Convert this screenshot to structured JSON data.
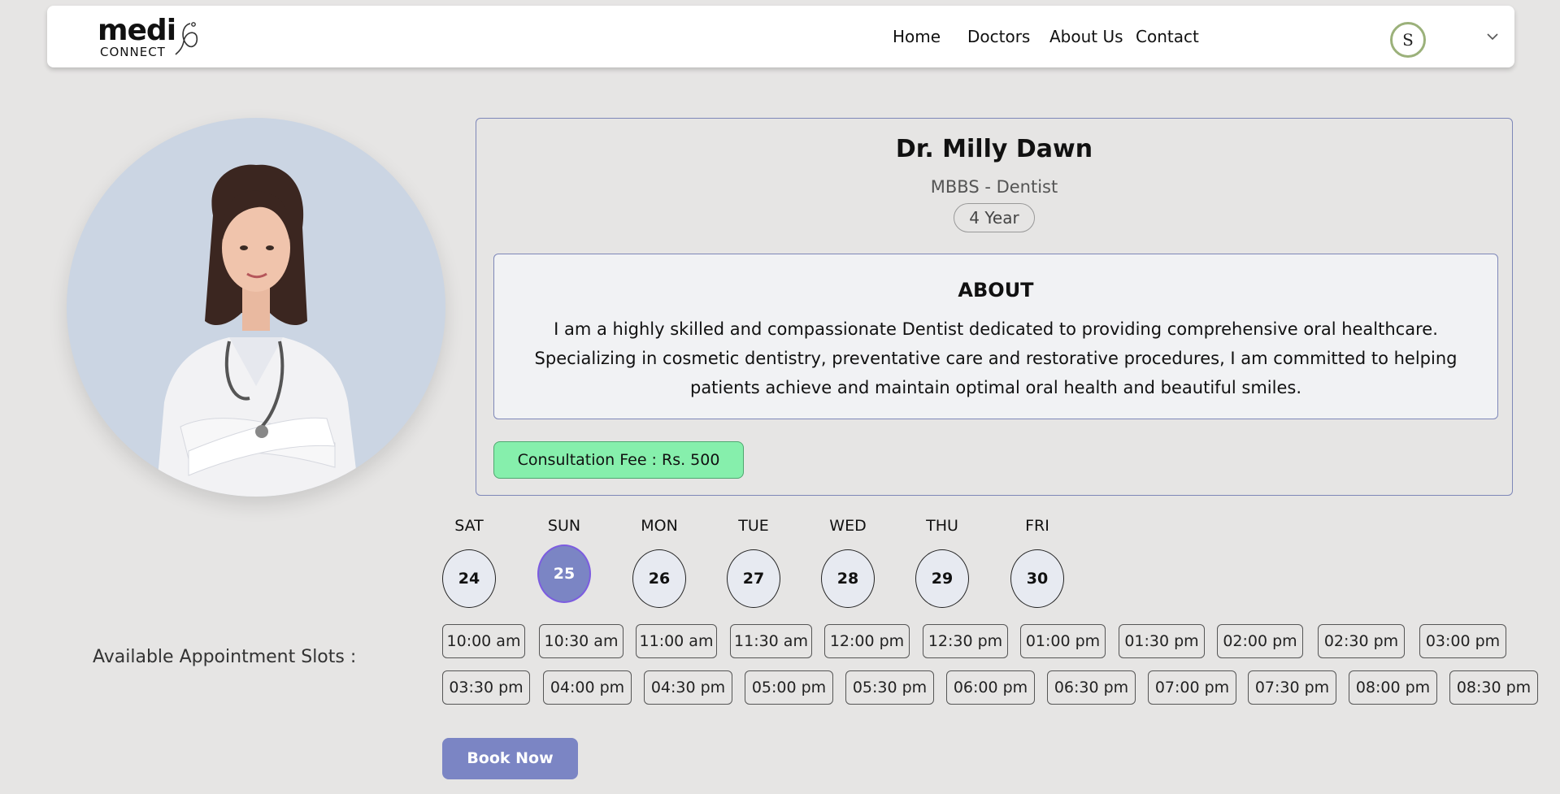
{
  "brand": {
    "name_main": "medi",
    "name_sub": "CONNECT"
  },
  "nav": {
    "items": [
      "Home",
      "Doctors",
      "About Us",
      "Contact"
    ],
    "avatar_initial": "S"
  },
  "doctor": {
    "name": "Dr. Milly Dawn",
    "specialty": "MBBS - Dentist",
    "experience": "4 Year",
    "about_title": "ABOUT",
    "about_text": "I am a highly skilled and compassionate Dentist dedicated to providing comprehensive oral healthcare. Specializing in cosmetic dentistry, preventative care and restorative procedures, I am committed to helping patients achieve and maintain optimal oral health and beautiful smiles.",
    "fee": "Consultation Fee : Rs. 500"
  },
  "days": [
    {
      "name": "SAT",
      "num": "24"
    },
    {
      "name": "SUN",
      "num": "25",
      "selected": true
    },
    {
      "name": "MON",
      "num": "26"
    },
    {
      "name": "TUE",
      "num": "27"
    },
    {
      "name": "WED",
      "num": "28"
    },
    {
      "name": "THU",
      "num": "29"
    },
    {
      "name": "FRI",
      "num": "30"
    }
  ],
  "slots_label": "Available Appointment Slots :",
  "slots_row1": [
    "10:00 am",
    "10:30 am",
    "11:00 am",
    "11:30 am",
    "12:00 pm",
    "12:30 pm",
    "01:00 pm",
    "01:30 pm",
    "02:00 pm",
    "02:30 pm",
    "03:00 pm"
  ],
  "slots_row2": [
    "03:30 pm",
    "04:00 pm",
    "04:30 pm",
    "05:00 pm",
    "05:30 pm",
    "06:00 pm",
    "06:30 pm",
    "07:00 pm",
    "07:30 pm",
    "08:00 pm",
    "08:30 pm"
  ],
  "book_label": "Book Now",
  "colors": {
    "accent": "#7b85c4",
    "fee_bg": "#86efac",
    "page_bg": "#e6e5e4"
  }
}
